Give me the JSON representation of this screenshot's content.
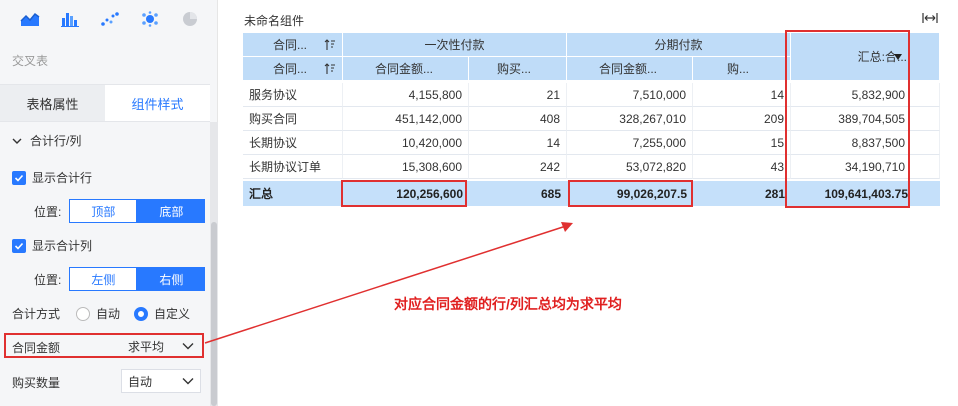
{
  "left_panel": {
    "chart_icons": [
      "area-chart-icon",
      "bar-chart-icon",
      "scatter-chart-icon",
      "bubble-chart-icon",
      "pie-chart-icon"
    ],
    "panel_title": "交叉表",
    "tabs": [
      {
        "label": "表格属性"
      },
      {
        "label": "组件样式"
      }
    ],
    "section_label": "合计行/列",
    "show_total_row": "显示合计行",
    "show_total_col": "显示合计列",
    "position_label": "位置:",
    "row_positions": [
      "顶部",
      "底部"
    ],
    "col_positions": [
      "左侧",
      "右侧"
    ],
    "total_method_label": "合计方式",
    "total_method_options": [
      "自动",
      "自定义"
    ],
    "fields": [
      {
        "label": "合同金额",
        "value": "求平均"
      },
      {
        "label": "购买数量",
        "value": "自动"
      }
    ]
  },
  "component": {
    "title": "未命名组件"
  },
  "table": {
    "header_row1": {
      "dim": "合同...",
      "group1": "一次性付款",
      "group2": "分期付款",
      "total": "汇总:合..."
    },
    "header_row2": {
      "dim": "合同...",
      "c1": "合同金额...",
      "c2": "购买...",
      "c3": "合同金额...",
      "c4": "购..."
    },
    "rows": [
      {
        "label": "服务协议",
        "v1": "4,155,800",
        "v2": "21",
        "v3": "7,510,000",
        "v4": "14",
        "total": "5,832,900"
      },
      {
        "label": "购买合同",
        "v1": "451,142,000",
        "v2": "408",
        "v3": "328,267,010",
        "v4": "209",
        "total": "389,704,505"
      },
      {
        "label": "长期协议",
        "v1": "10,420,000",
        "v2": "14",
        "v3": "7,255,000",
        "v4": "15",
        "total": "8,837,500"
      },
      {
        "label": "长期协议订单",
        "v1": "15,308,600",
        "v2": "242",
        "v3": "53,072,820",
        "v4": "43",
        "total": "34,190,710"
      }
    ],
    "total_row": {
      "label": "汇总",
      "v1": "120,256,600",
      "v2": "685",
      "v3": "99,026,207.5",
      "v4": "281",
      "total": "109,641,403.75"
    }
  },
  "annotation": "对应合同金额的行/列汇总均为求平均",
  "colors": {
    "accent": "#2879ff",
    "header_bg": "#bfdcf8",
    "total_bg": "#c5e0fa",
    "highlight": "#e03030"
  }
}
